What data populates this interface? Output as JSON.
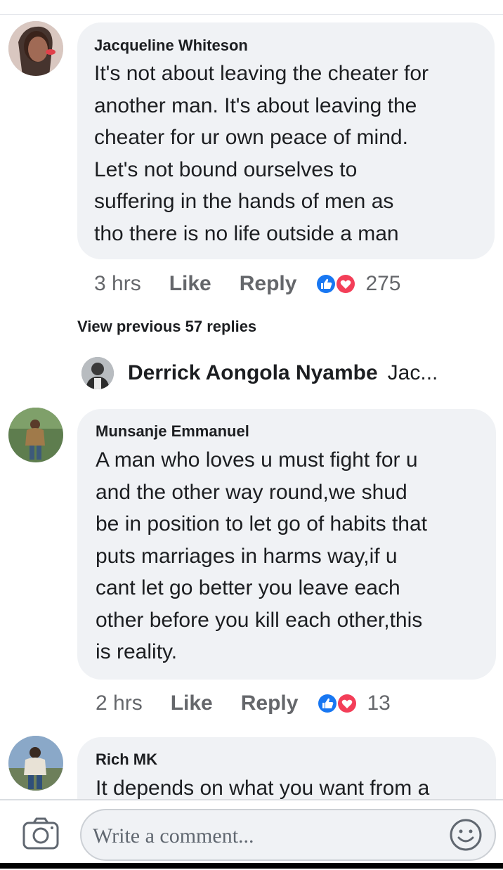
{
  "comments": [
    {
      "author": "Jacqueline Whiteson",
      "text": "It's not about leaving the cheater for\nanother man. It's about leaving the\ncheater for ur own peace of mind.\nLet's not bound ourselves to\nsuffering in the hands of men as\ntho there is no life outside a man",
      "time": "3 hrs",
      "like_label": "Like",
      "reply_label": "Reply",
      "reaction_count": "275"
    },
    {
      "author": "Munsanje Emmanuel",
      "text": "A man who loves u must fight for u\nand the other way round,we shud\nbe in position to let go of habits that\nputs marriages in harms way,if u\ncant let go better you leave each\nother before you kill each other,this\nis reality.",
      "time": "2 hrs",
      "like_label": "Like",
      "reply_label": "Reply",
      "reaction_count": "13"
    },
    {
      "author": "Rich MK",
      "text": "It depends on what you want from a"
    }
  ],
  "view_previous": "View previous 57 replies",
  "collapsed_reply": {
    "author": "Derrick Aongola Nyambe",
    "snippet": "Jac..."
  },
  "composer": {
    "placeholder": "Write a comment..."
  },
  "colors": {
    "like_blue": "#1877f2",
    "love_red": "#f33e58",
    "bubble": "#f0f2f5",
    "meta_gray": "#65676b"
  }
}
